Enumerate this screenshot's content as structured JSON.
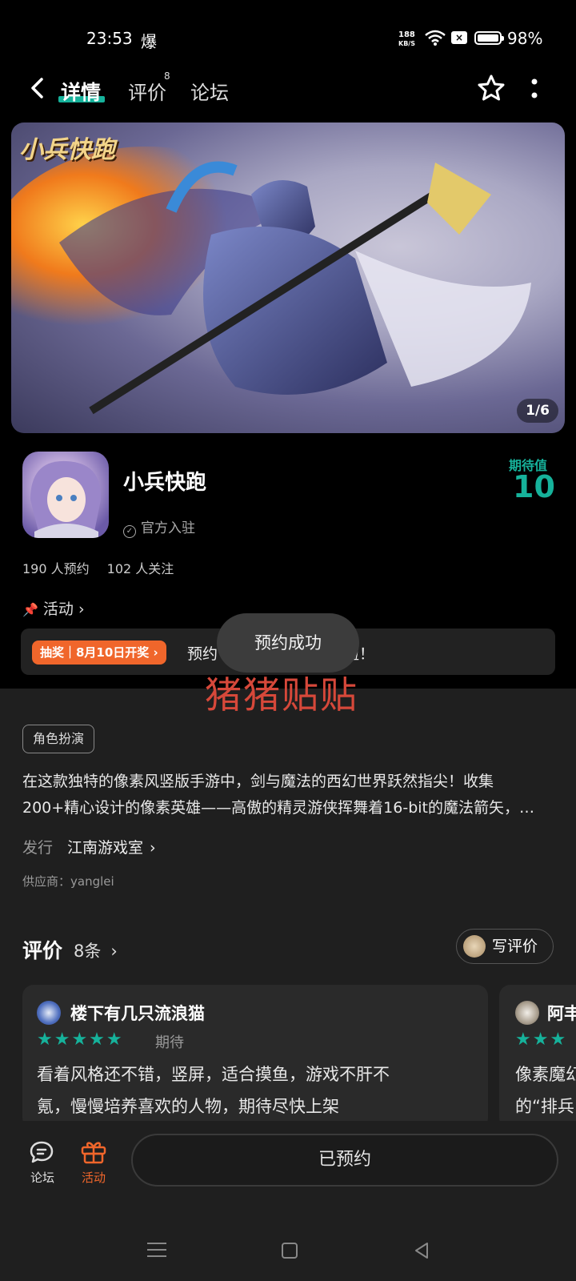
{
  "status_bar": {
    "time": "23:53",
    "extra_icon": "爆",
    "net_speed_value": "188",
    "net_speed_unit": "KB/S",
    "battery_pct": "98%"
  },
  "nav": {
    "tabs": [
      {
        "label": "详情"
      },
      {
        "label": "评价"
      },
      {
        "label": "论坛"
      }
    ],
    "review_badge": "8"
  },
  "banner": {
    "logo_text": "小兵快跑",
    "counter": "1/6"
  },
  "game": {
    "name": "小兵快跑",
    "official_label": "官方入驻",
    "expect_label": "期待值",
    "expect_value": "10",
    "reservations": "190 人预约",
    "follows": "102 人关注"
  },
  "activity": {
    "header": "活动",
    "badge": "抽奖｜8月10日开奖",
    "text": "预约                              利】预约送京东卡啦！"
  },
  "toast": {
    "text": "预约成功"
  },
  "watermark": "猪猪贴贴",
  "details": {
    "genre": "角色扮演",
    "desc_line1": "在这款独特的像素风竖版手游中，剑与魔法的西幻世界跃然指尖！收集",
    "desc_line2": "200+精心设计的像素英雄——高傲的精灵游侠挥舞着16-bit的魔法箭矢，…",
    "publisher_label": "发行",
    "publisher": "江南游戏室",
    "supplier": "供应商：yanglei"
  },
  "reviews": {
    "title": "评价",
    "count": "8条",
    "write_label": "写评价",
    "cards": [
      {
        "user": "楼下有几只流浪猫",
        "stars": "★★★★★",
        "tag": "期待",
        "line1": "看着风格还不错，竖屏，适合摸鱼，游戏不肝不",
        "line2": "氪，慢慢培养喜欢的人物，期待尽快上架"
      },
      {
        "user": "阿丰",
        "stars": "★★★",
        "line1": "像素魔幻",
        "line2": "的“排兵"
      }
    ]
  },
  "bottom_bar": {
    "forum_label": "论坛",
    "activity_label": "活动",
    "reserve_button": "已预约"
  },
  "colors": {
    "accent": "#16b29b",
    "orange": "#f0662b",
    "watermark": "#d6483a"
  }
}
